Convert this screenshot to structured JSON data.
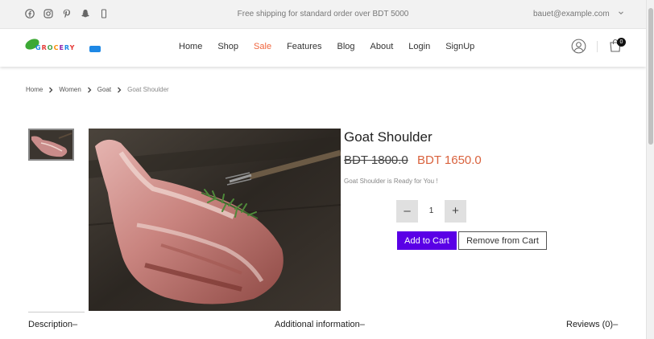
{
  "topbar": {
    "social_icons": [
      "facebook-icon",
      "instagram-icon",
      "pinterest-icon",
      "snapchat-icon",
      "mobile-icon"
    ],
    "promo_text": "Free shipping for standard order over BDT 5000",
    "account_email": "bauet@example.com"
  },
  "header": {
    "logo_text": [
      "G",
      "R",
      "O",
      "C",
      "E",
      "R",
      "Y"
    ],
    "nav": [
      {
        "label": "Home",
        "active": false
      },
      {
        "label": "Shop",
        "active": false
      },
      {
        "label": "Sale",
        "active": true
      },
      {
        "label": "Features",
        "active": false
      },
      {
        "label": "Blog",
        "active": false
      },
      {
        "label": "About",
        "active": false
      },
      {
        "label": "Login",
        "active": false
      },
      {
        "label": "SignUp",
        "active": false
      }
    ],
    "cart_count": "0",
    "accent_color": "#f0643c"
  },
  "breadcrumb": {
    "items": [
      "Home",
      "Women",
      "Goat"
    ],
    "current": "Goat Shoulder"
  },
  "product": {
    "title": "Goat Shoulder",
    "price_old": "BDT 1800.0",
    "price_new": "BDT 1650.0",
    "description": "Goat Shoulder is Ready for You !",
    "quantity": "1",
    "minus_label": "–",
    "plus_label": "+",
    "add_to_cart": "Add to Cart",
    "remove_from_cart": "Remove from Cart",
    "add_button_color": "#5a00e6"
  },
  "tabs": {
    "description": "Description–",
    "additional_info": "Additional information–",
    "reviews": "Reviews (0)–"
  }
}
